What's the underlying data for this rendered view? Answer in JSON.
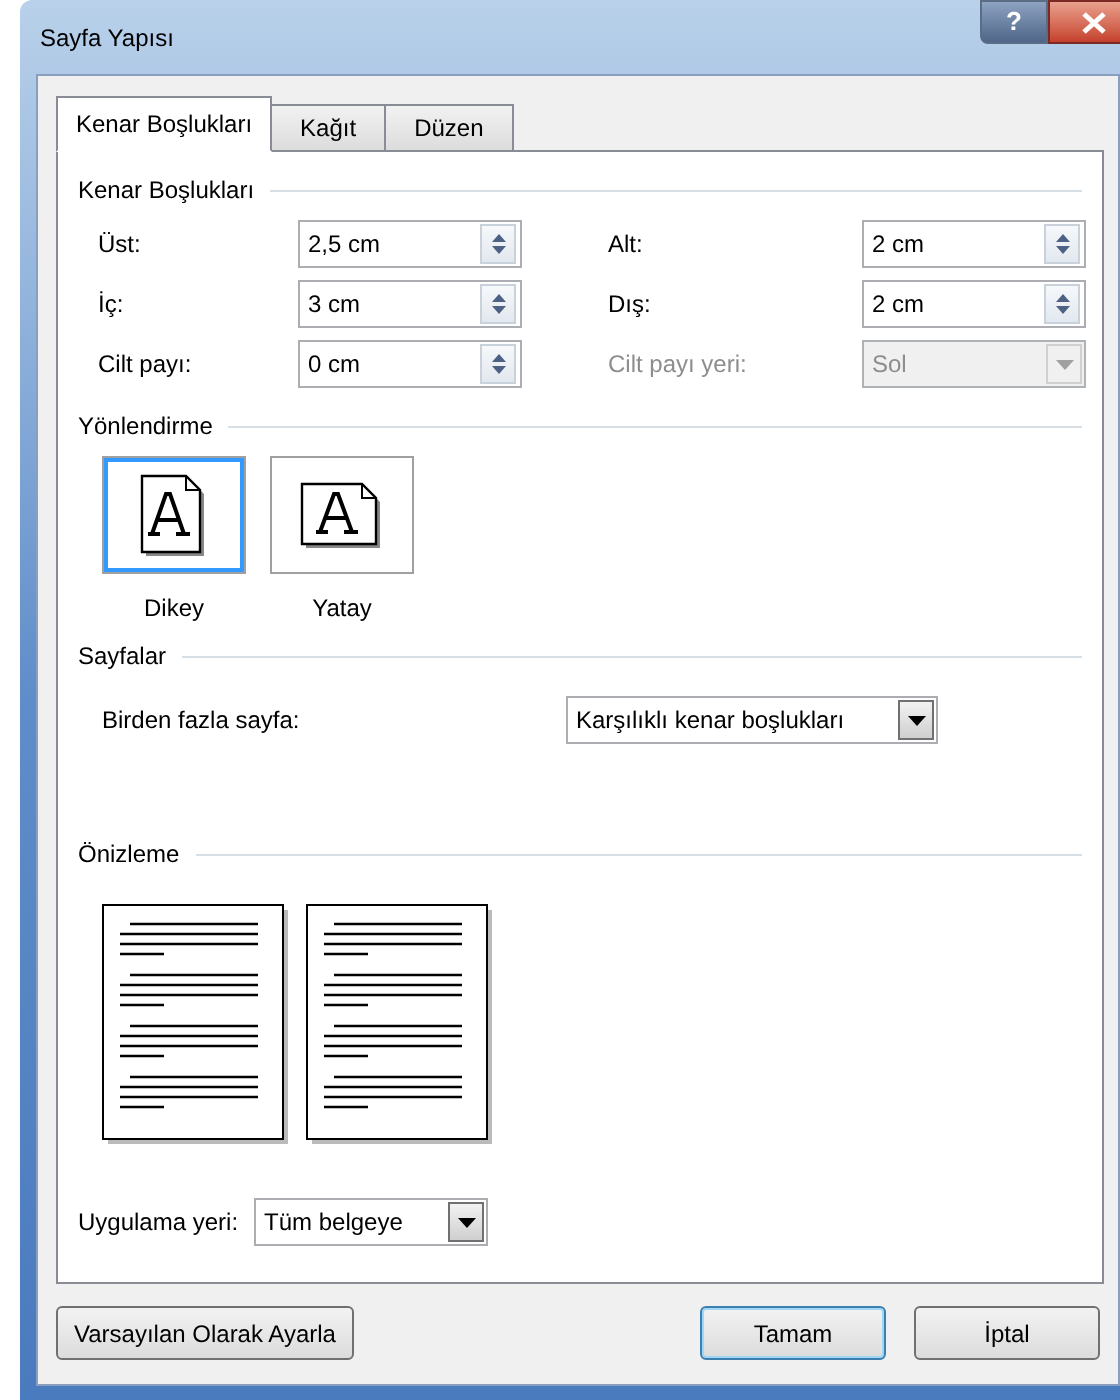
{
  "window": {
    "title": "Sayfa Yapısı",
    "help_button": "?"
  },
  "tabs": [
    {
      "label": "Kenar Boşlukları",
      "selected": true
    },
    {
      "label": "Kağıt",
      "selected": false
    },
    {
      "label": "Düzen",
      "selected": false
    }
  ],
  "margins": {
    "heading": "Kenar Boşlukları",
    "fields": [
      {
        "label": "Üst:",
        "value": "2,5 cm",
        "kind": "spin",
        "disabled": false
      },
      {
        "label": "Alt:",
        "value": "2 cm",
        "kind": "spin",
        "disabled": false
      },
      {
        "label": "İç:",
        "value": "3 cm",
        "kind": "spin",
        "disabled": false
      },
      {
        "label": "Dış:",
        "value": "2 cm",
        "kind": "spin",
        "disabled": false
      },
      {
        "label": "Cilt payı:",
        "value": "0 cm",
        "kind": "spin",
        "disabled": false
      },
      {
        "label": "Cilt payı yeri:",
        "value": "Sol",
        "kind": "dropdown",
        "disabled": true
      }
    ]
  },
  "orientation": {
    "heading": "Yönlendirme",
    "options": [
      {
        "label": "Dikey",
        "kind": "portrait",
        "selected": true
      },
      {
        "label": "Yatay",
        "kind": "landscape",
        "selected": false
      }
    ]
  },
  "pages": {
    "heading": "Sayfalar",
    "label": "Birden fazla sayfa:",
    "value": "Karşılıklı kenar boşlukları"
  },
  "preview": {
    "heading": "Önizleme"
  },
  "apply_to": {
    "label": "Uygulama yeri:",
    "value": "Tüm belgeye"
  },
  "buttons": [
    {
      "label": "Varsayılan Olarak Ayarla",
      "kind": "secondary",
      "default": false
    },
    {
      "label": "Tamam",
      "kind": "primary",
      "default": true
    },
    {
      "label": "İptal",
      "kind": "primary",
      "default": false
    }
  ]
}
